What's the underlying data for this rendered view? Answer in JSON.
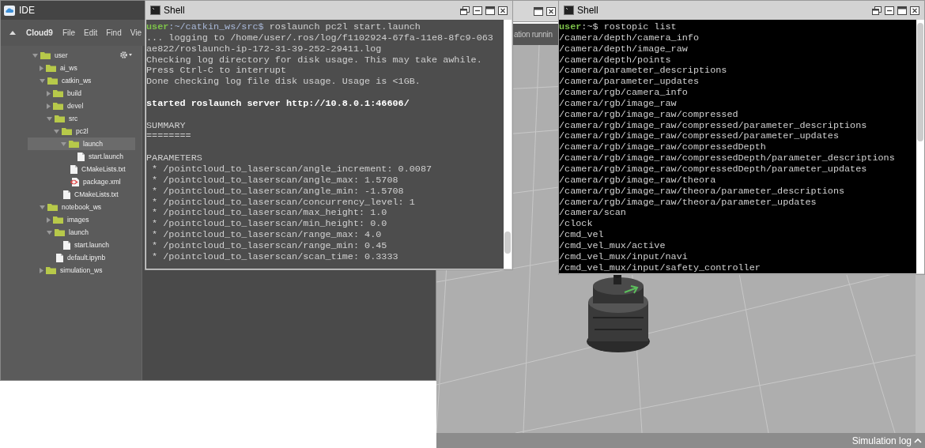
{
  "ide": {
    "title": "IDE",
    "brand": "Cloud9",
    "menu": [
      "File",
      "Edit",
      "Find",
      "Vie"
    ],
    "tree": [
      {
        "label": "user",
        "kind": "folder",
        "expanded": true,
        "selected": false,
        "children": [
          {
            "label": "ai_ws",
            "kind": "folder",
            "expanded": false,
            "selected": false
          },
          {
            "label": "catkin_ws",
            "kind": "folder",
            "expanded": true,
            "selected": false,
            "children": [
              {
                "label": "build",
                "kind": "folder",
                "expanded": false,
                "selected": false
              },
              {
                "label": "devel",
                "kind": "folder",
                "expanded": false,
                "selected": false
              },
              {
                "label": "src",
                "kind": "folder",
                "expanded": true,
                "selected": false,
                "children": [
                  {
                    "label": "pc2l",
                    "kind": "folder",
                    "expanded": true,
                    "selected": false,
                    "children": [
                      {
                        "label": "launch",
                        "kind": "folder",
                        "expanded": true,
                        "selected": true,
                        "children": [
                          {
                            "label": "start.launch",
                            "kind": "file",
                            "selected": false
                          }
                        ]
                      },
                      {
                        "label": "CMakeLists.txt",
                        "kind": "file",
                        "selected": false
                      },
                      {
                        "label": "package.xml",
                        "kind": "xml",
                        "selected": false
                      }
                    ]
                  },
                  {
                    "label": "CMakeLists.txt",
                    "kind": "file",
                    "selected": false
                  }
                ]
              }
            ]
          },
          {
            "label": "notebook_ws",
            "kind": "folder",
            "expanded": true,
            "selected": false,
            "children": [
              {
                "label": "images",
                "kind": "folder",
                "expanded": false,
                "selected": false
              },
              {
                "label": "launch",
                "kind": "folder",
                "expanded": true,
                "selected": false,
                "children": [
                  {
                    "label": "start.launch",
                    "kind": "file",
                    "selected": false
                  }
                ]
              },
              {
                "label": "default.ipynb",
                "kind": "file",
                "selected": false
              }
            ]
          },
          {
            "label": "simulation_ws",
            "kind": "folder",
            "expanded": false,
            "selected": false
          }
        ]
      }
    ]
  },
  "simulation": {
    "status": "ation runnin",
    "log_button": "Simulation log"
  },
  "launch_shell": {
    "title": "Shell",
    "lines": [
      {
        "kind": "prompt",
        "user": "user",
        "path": ":~/catkin_ws/src$",
        "command": " roslaunch pc2l start.launch"
      },
      {
        "kind": "output",
        "text": "... logging to /home/user/.ros/log/f1102924-67fa-11e8-8fc9-063"
      },
      {
        "kind": "output",
        "text": "ae822/roslaunch-ip-172-31-39-252-29411.log"
      },
      {
        "kind": "output",
        "text": "Checking log directory for disk usage. This may take awhile."
      },
      {
        "kind": "output",
        "text": "Press Ctrl-C to interrupt"
      },
      {
        "kind": "output",
        "text": "Done checking log file disk usage. Usage is <1GB."
      },
      {
        "kind": "blank"
      },
      {
        "kind": "bold",
        "text": "started roslaunch server http://10.8.0.1:46606/"
      },
      {
        "kind": "blank"
      },
      {
        "kind": "output",
        "text": "SUMMARY"
      },
      {
        "kind": "output",
        "text": "========"
      },
      {
        "kind": "blank"
      },
      {
        "kind": "output",
        "text": "PARAMETERS"
      },
      {
        "kind": "output",
        "text": " * /pointcloud_to_laserscan/angle_increment: 0.0087"
      },
      {
        "kind": "output",
        "text": " * /pointcloud_to_laserscan/angle_max: 1.5708"
      },
      {
        "kind": "output",
        "text": " * /pointcloud_to_laserscan/angle_min: -1.5708"
      },
      {
        "kind": "output",
        "text": " * /pointcloud_to_laserscan/concurrency_level: 1"
      },
      {
        "kind": "output",
        "text": " * /pointcloud_to_laserscan/max_height: 1.0"
      },
      {
        "kind": "output",
        "text": " * /pointcloud_to_laserscan/min_height: 0.0"
      },
      {
        "kind": "output",
        "text": " * /pointcloud_to_laserscan/range_max: 4.0"
      },
      {
        "kind": "output",
        "text": " * /pointcloud_to_laserscan/range_min: 0.45"
      },
      {
        "kind": "output",
        "text": " * /pointcloud_to_laserscan/scan_time: 0.3333"
      }
    ]
  },
  "topic_shell": {
    "title": "Shell",
    "lines": [
      {
        "kind": "prompt",
        "user": "user",
        "path": ":~$",
        "command": " rostopic list"
      },
      {
        "kind": "output",
        "text": "/camera/depth/camera_info"
      },
      {
        "kind": "output",
        "text": "/camera/depth/image_raw"
      },
      {
        "kind": "output",
        "text": "/camera/depth/points"
      },
      {
        "kind": "output",
        "text": "/camera/parameter_descriptions"
      },
      {
        "kind": "output",
        "text": "/camera/parameter_updates"
      },
      {
        "kind": "output",
        "text": "/camera/rgb/camera_info"
      },
      {
        "kind": "output",
        "text": "/camera/rgb/image_raw"
      },
      {
        "kind": "output",
        "text": "/camera/rgb/image_raw/compressed"
      },
      {
        "kind": "output",
        "text": "/camera/rgb/image_raw/compressed/parameter_descriptions"
      },
      {
        "kind": "output",
        "text": "/camera/rgb/image_raw/compressed/parameter_updates"
      },
      {
        "kind": "output",
        "text": "/camera/rgb/image_raw/compressedDepth"
      },
      {
        "kind": "output",
        "text": "/camera/rgb/image_raw/compressedDepth/parameter_descriptions"
      },
      {
        "kind": "output",
        "text": "/camera/rgb/image_raw/compressedDepth/parameter_updates"
      },
      {
        "kind": "output",
        "text": "/camera/rgb/image_raw/theora"
      },
      {
        "kind": "output",
        "text": "/camera/rgb/image_raw/theora/parameter_descriptions"
      },
      {
        "kind": "output",
        "text": "/camera/rgb/image_raw/theora/parameter_updates"
      },
      {
        "kind": "output",
        "text": "/camera/scan"
      },
      {
        "kind": "output",
        "text": "/clock"
      },
      {
        "kind": "output",
        "text": "/cmd_vel"
      },
      {
        "kind": "output",
        "text": "/cmd_vel_mux/active"
      },
      {
        "kind": "output",
        "text": "/cmd_vel_mux/input/navi"
      },
      {
        "kind": "output",
        "text": "/cmd_vel_mux/input/safety_controller"
      }
    ]
  }
}
